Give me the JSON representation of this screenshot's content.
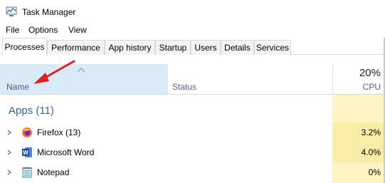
{
  "window": {
    "title": "Task Manager"
  },
  "menu": [
    "File",
    "Options",
    "View"
  ],
  "tabs": [
    "Processes",
    "Performance",
    "App history",
    "Startup",
    "Users",
    "Details",
    "Services"
  ],
  "columns": {
    "name": "Name",
    "status": "Status",
    "cpu_total": "20%",
    "cpu": "CPU"
  },
  "section": {
    "label": "Apps (11)"
  },
  "rows": [
    {
      "name": "Firefox (13)",
      "cpu": "3.2%",
      "icon": "firefox-icon"
    },
    {
      "name": "Microsoft Word",
      "cpu": "4.0%",
      "icon": "word-icon"
    },
    {
      "name": "Notepad",
      "cpu": "0%",
      "icon": "notepad-icon"
    }
  ],
  "colors": {
    "accent": "#2f65a6",
    "header_highlight": "#d9ebf9",
    "cpu_light": "#fff4c4",
    "cpu_medium": "#f9eca7",
    "annotation_arrow": "#e02020"
  }
}
